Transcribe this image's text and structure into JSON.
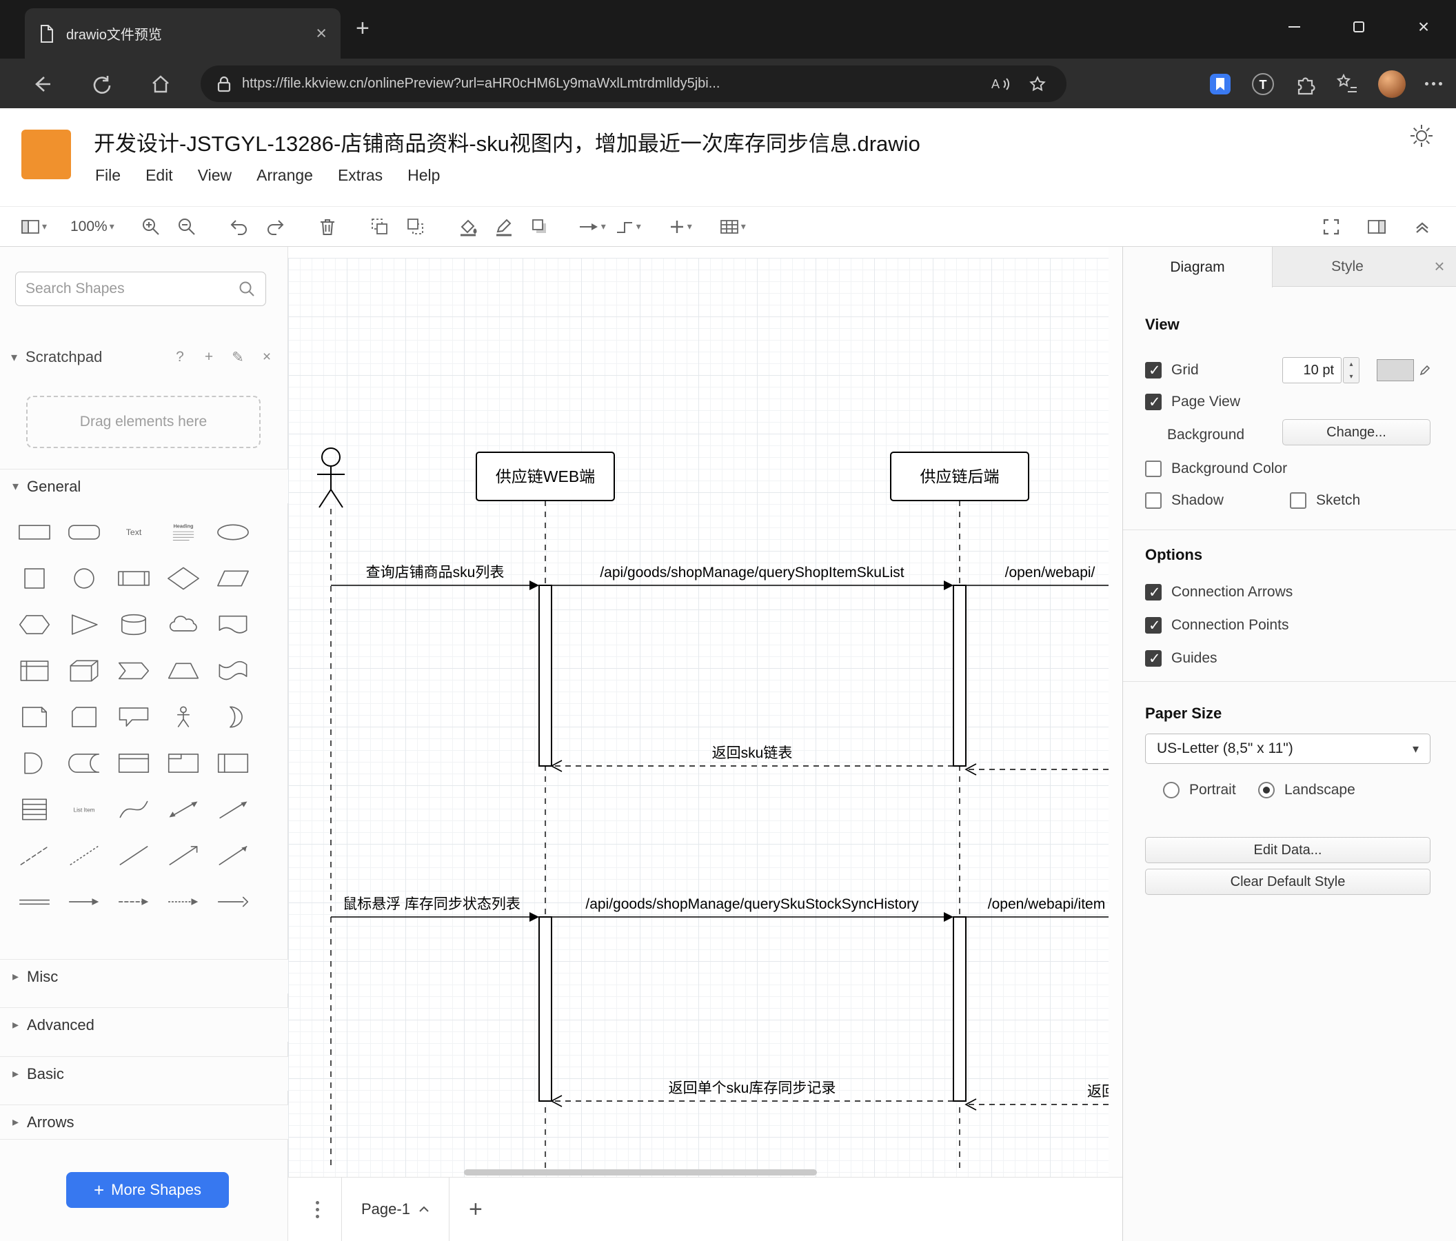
{
  "browser": {
    "tab_title": "drawio文件预览",
    "url": "https://file.kkview.cn/onlinePreview?url=aHR0cHM6Ly9maWxlLmtrdmlldy5jbi..."
  },
  "app": {
    "title": "开发设计-JSTGYL-13286-店铺商品资料-sku视图内，增加最近一次库存同步信息.drawio",
    "menus": [
      "File",
      "Edit",
      "View",
      "Arrange",
      "Extras",
      "Help"
    ],
    "zoom_level": "100%"
  },
  "sidebar": {
    "search_placeholder": "Search Shapes",
    "scratchpad_label": "Scratchpad",
    "drag_hint": "Drag elements here",
    "section_labels": [
      "General",
      "Misc",
      "Advanced",
      "Basic",
      "Arrows"
    ],
    "more_shapes_label": "More Shapes",
    "palette_shapes": [
      "rectangle",
      "rounded-rectangle",
      "text",
      "heading",
      "ellipse",
      "square",
      "circle",
      "process",
      "diamond",
      "parallelogram",
      "hexagon",
      "triangle",
      "cylinder",
      "cloud",
      "document",
      "internal-storage",
      "cube",
      "step",
      "trapezoid",
      "tape",
      "note",
      "card",
      "callout",
      "actor",
      "or",
      "and",
      "data-storage",
      "container",
      "frame",
      "horizontal-container",
      "list",
      "list-item",
      "curve",
      "bidirectional-arrow",
      "diagonal-arrow",
      "dashed-line",
      "dotted-line",
      "line",
      "bidirectional-connector",
      "directional-connector",
      "link",
      "horizontal-arrow",
      "dashed-horizontal-arrow",
      "dotted-horizontal-arrow",
      "horizontal-connector"
    ]
  },
  "canvas": {
    "page_label": "Page-1",
    "diagram": {
      "type": "sequence",
      "participants": [
        {
          "id": "user",
          "kind": "actor",
          "label": ""
        },
        {
          "id": "web",
          "kind": "lifeline",
          "label": "供应链WEB端"
        },
        {
          "id": "backend",
          "kind": "lifeline",
          "label": "供应链后端"
        }
      ],
      "messages": [
        {
          "from": "user",
          "to": "web",
          "kind": "call",
          "label": "查询店铺商品sku列表"
        },
        {
          "from": "web",
          "to": "backend",
          "kind": "call",
          "label": "/api/goods/shopManage/queryShopItemSkuList"
        },
        {
          "from": "backend",
          "to": "offscreen",
          "kind": "call",
          "label": "/open/webapi/"
        },
        {
          "from": "backend",
          "to": "web",
          "kind": "return",
          "label": "返回sku链表"
        },
        {
          "from": "offscreen",
          "to": "backend",
          "kind": "return",
          "label": ""
        },
        {
          "from": "user",
          "to": "web",
          "kind": "call",
          "label": "鼠标悬浮 库存同步状态列表"
        },
        {
          "from": "web",
          "to": "backend",
          "kind": "call",
          "label": "/api/goods/shopManage/querySkuStockSyncHistory"
        },
        {
          "from": "backend",
          "to": "offscreen",
          "kind": "call",
          "label": "/open/webapi/item"
        },
        {
          "from": "backend",
          "to": "web",
          "kind": "return",
          "label": "返回单个sku库存同步记录"
        },
        {
          "from": "offscreen",
          "to": "backend",
          "kind": "return",
          "label": "返回"
        }
      ]
    }
  },
  "format_panel": {
    "tabs": [
      "Diagram",
      "Style"
    ],
    "active_tab": "Diagram",
    "view": {
      "header": "View",
      "grid_label": "Grid",
      "grid_checked": true,
      "grid_size": "10 pt",
      "grid_color": "#d9d9d9",
      "page_view_label": "Page View",
      "page_view_checked": true,
      "background_label": "Background",
      "change_button": "Change...",
      "background_color_label": "Background Color",
      "background_color_checked": false,
      "shadow_label": "Shadow",
      "shadow_checked": false,
      "sketch_label": "Sketch",
      "sketch_checked": false
    },
    "options": {
      "header": "Options",
      "connection_arrows_label": "Connection Arrows",
      "connection_arrows_checked": true,
      "connection_points_label": "Connection Points",
      "connection_points_checked": true,
      "guides_label": "Guides",
      "guides_checked": true
    },
    "paper": {
      "header": "Paper Size",
      "size_value": "US-Letter (8,5\" x 11\")",
      "portrait_label": "Portrait",
      "portrait_checked": false,
      "landscape_label": "Landscape",
      "landscape_checked": true
    },
    "actions": {
      "edit_data": "Edit Data...",
      "clear_default_style": "Clear Default Style"
    }
  },
  "icons": {
    "favicon": "document-outline",
    "tab-close": "×",
    "new-tab": "+",
    "minimize": "–",
    "maximize": "□",
    "close": "×",
    "back": "left-arrow",
    "refresh": "circular-arrow",
    "home": "house",
    "lock": "padlock",
    "read-aloud": "A)",
    "favorite": "star",
    "extensions": "puzzle",
    "profile": "avatar-circle",
    "more": "ellipsis",
    "theme": "sun",
    "search": "magnifier",
    "page-menu": "kebab-dots"
  }
}
